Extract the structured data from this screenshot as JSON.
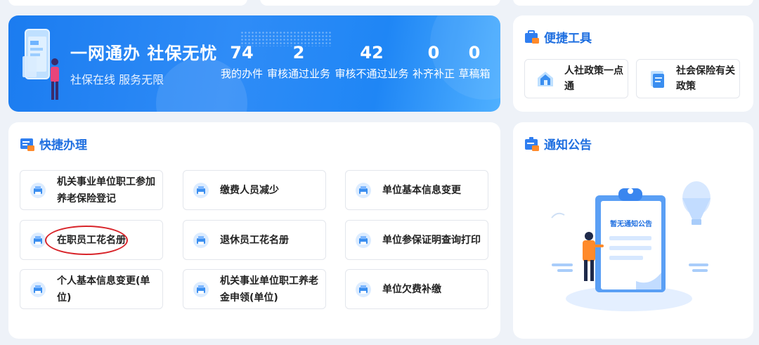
{
  "banner": {
    "title": "一网通办 社保无忧",
    "subtitle": "社保在线  服务无限",
    "stats": [
      {
        "value": "74",
        "label": "我的办件"
      },
      {
        "value": "2",
        "label": "审核通过业务"
      },
      {
        "value": "42",
        "label": "审核不通过业务"
      },
      {
        "value": "0",
        "label": "补齐补正"
      },
      {
        "value": "0",
        "label": "草稿箱"
      }
    ]
  },
  "tools": {
    "title": "便捷工具",
    "items": [
      {
        "label": "人社政策一点通"
      },
      {
        "label": "社会保险有关政策"
      }
    ]
  },
  "quick": {
    "title": "快捷办理",
    "items": [
      {
        "label": "机关事业单位职工参加养老保险登记"
      },
      {
        "label": "缴费人员减少"
      },
      {
        "label": "单位基本信息变更"
      },
      {
        "label": "在职员工花名册"
      },
      {
        "label": "退休员工花名册"
      },
      {
        "label": "单位参保证明查询打印"
      },
      {
        "label": "个人基本信息变更(单位)"
      },
      {
        "label": "机关事业单位职工养老金申领(单位)"
      },
      {
        "label": "单位欠费补缴"
      }
    ]
  },
  "notice": {
    "title": "通知公告",
    "empty_text": "暂无通知公告"
  },
  "colors": {
    "accent": "#1f6fe0",
    "banner_blue": "#2f8cf7",
    "annotation_red": "#d8242a",
    "icon_blue": "#3a8ef0",
    "icon_orange": "#ff8a2a"
  }
}
